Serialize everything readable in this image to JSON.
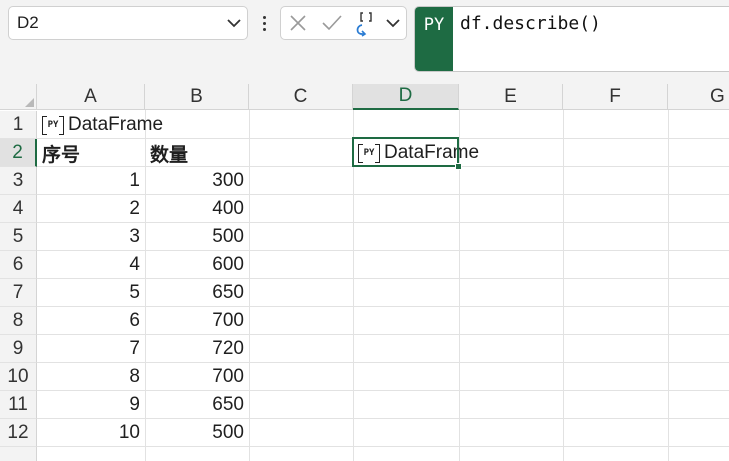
{
  "namebox": {
    "value": "D2"
  },
  "formula": {
    "badge": "PY",
    "text": "df.describe()",
    "accent": "#1e6b43"
  },
  "columns": [
    "A",
    "B",
    "C",
    "D",
    "E",
    "F",
    "G"
  ],
  "selected": {
    "column": "D",
    "row": "2"
  },
  "rows": [
    "1",
    "2",
    "3",
    "4",
    "5",
    "6",
    "7",
    "8",
    "9",
    "10",
    "11",
    "12"
  ],
  "cells": {
    "a1": "DataFrame",
    "a2": "序号",
    "b2": "数量",
    "d2": "DataFrame",
    "data": [
      {
        "a": "1",
        "b": "300"
      },
      {
        "a": "2",
        "b": "400"
      },
      {
        "a": "3",
        "b": "500"
      },
      {
        "a": "4",
        "b": "600"
      },
      {
        "a": "5",
        "b": "650"
      },
      {
        "a": "6",
        "b": "700"
      },
      {
        "a": "7",
        "b": "720"
      },
      {
        "a": "8",
        "b": "700"
      },
      {
        "a": "9",
        "b": "650"
      },
      {
        "a": "10",
        "b": "500"
      }
    ]
  },
  "icons": {
    "namebox_dropdown": "chevron-down-icon",
    "more": "more-options-icon",
    "cancel": "cancel-x-icon",
    "enter": "check-icon",
    "output": "python-output-type-icon",
    "dataframe": "python-object-icon"
  }
}
